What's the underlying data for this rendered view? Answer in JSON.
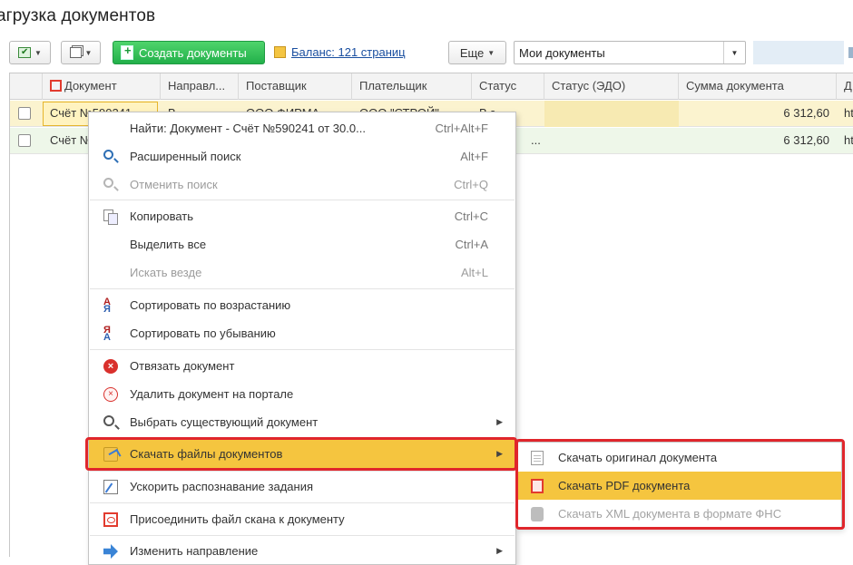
{
  "page_title": "агрузка документов",
  "toolbar": {
    "create_label": "Создать документы",
    "balance_label": "Баланс: 121 страниц",
    "more_label": "Еще",
    "filter_value": "Мои документы"
  },
  "table": {
    "columns": [
      "Документ",
      "Направл...",
      "Поставщик",
      "Плательщик",
      "Статус",
      "Статус (ЭДО)",
      "Сумма документа",
      "Д"
    ],
    "rows": [
      {
        "document": "Счёт №590241",
        "direction": "В...",
        "supplier": "ООО ФИРМА",
        "payer": "ООО \"СТРОЙ\"",
        "status": "В з...",
        "edo_status": "",
        "sum": "6 312,60",
        "extra": "ht"
      },
      {
        "document": "Счёт №",
        "direction": "",
        "supplier": "",
        "payer": "",
        "status": "...",
        "edo_status": "",
        "sum": "6 312,60",
        "extra": "ht"
      }
    ]
  },
  "context_menu": {
    "items": [
      {
        "label": "Найти: Документ - Счёт №590241 от 30.0...",
        "shortcut": "Ctrl+Alt+F",
        "icon": "none",
        "disabled": false
      },
      {
        "label": "Расширенный поиск",
        "shortcut": "Alt+F",
        "icon": "search-icon",
        "disabled": false
      },
      {
        "label": "Отменить поиск",
        "shortcut": "Ctrl+Q",
        "icon": "cancel-search-icon",
        "disabled": true
      },
      {
        "label": "Копировать",
        "shortcut": "Ctrl+C",
        "icon": "copy-icon",
        "disabled": false
      },
      {
        "label": "Выделить все",
        "shortcut": "Ctrl+A",
        "icon": "none",
        "disabled": false
      },
      {
        "label": "Искать везде",
        "shortcut": "Alt+L",
        "icon": "none",
        "disabled": true
      },
      {
        "label": "Сортировать по возрастанию",
        "shortcut": "",
        "icon": "sort-asc-icon",
        "disabled": false
      },
      {
        "label": "Сортировать по убыванию",
        "shortcut": "",
        "icon": "sort-desc-icon",
        "disabled": false
      },
      {
        "label": "Отвязать документ",
        "shortcut": "",
        "icon": "unlink-icon",
        "disabled": false
      },
      {
        "label": "Удалить документ на портале",
        "shortcut": "",
        "icon": "delete-icon",
        "disabled": false
      },
      {
        "label": "Выбрать существующий документ",
        "shortcut": "",
        "icon": "magnifier-icon",
        "disabled": false
      },
      {
        "label": "Скачать файлы документов",
        "shortcut": "",
        "icon": "download-folder-icon",
        "disabled": false
      },
      {
        "label": "Ускорить распознавание задания",
        "shortcut": "",
        "icon": "speed-icon",
        "disabled": false
      },
      {
        "label": "Присоединить файл скана к документу",
        "shortcut": "",
        "icon": "pdf-icon",
        "disabled": false
      },
      {
        "label": "Изменить направление",
        "shortcut": "",
        "icon": "direction-icon",
        "disabled": false
      }
    ]
  },
  "submenu": {
    "items": [
      {
        "label": "Скачать оригинал документа",
        "icon": "document-icon",
        "disabled": false
      },
      {
        "label": "Скачать PDF документа",
        "icon": "pdf-icon",
        "disabled": false
      },
      {
        "label": "Скачать XML документа в формате ФНС",
        "icon": "xml-icon",
        "disabled": true
      }
    ]
  },
  "colors": {
    "highlight": "#f5c53f",
    "frame_red": "#e0262c",
    "create_green": "#22b04a",
    "row_selected": "#fbf3cf",
    "row_alt": "#eef7e9"
  }
}
